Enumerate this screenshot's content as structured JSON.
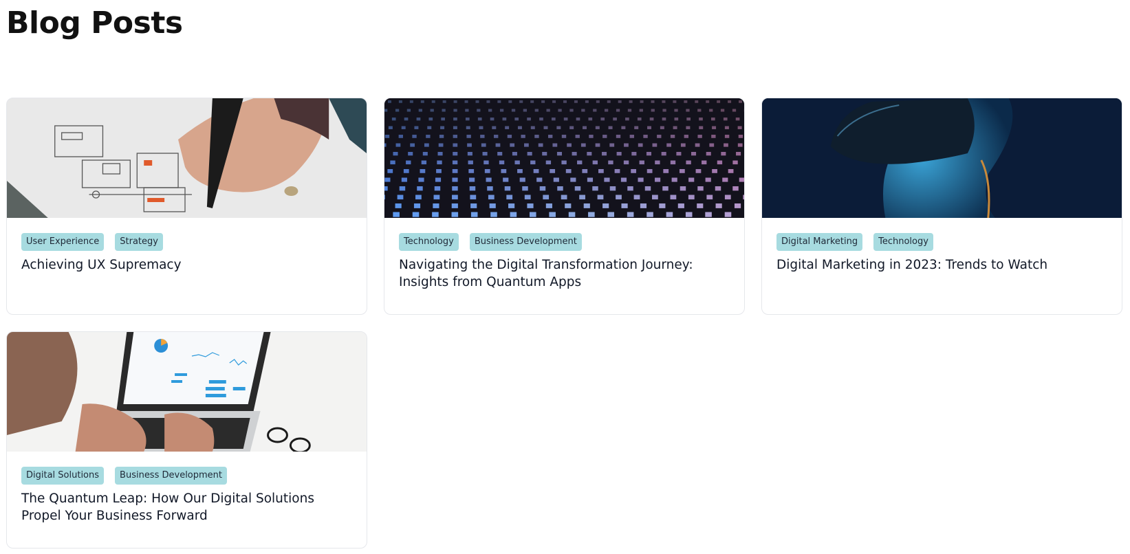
{
  "page": {
    "title": "Blog Posts"
  },
  "posts": [
    {
      "image": "hand-sketching-wireframe-image",
      "tags": [
        "User Experience",
        "Strategy"
      ],
      "title": "Achieving UX Supremacy"
    },
    {
      "image": "glowing-led-grid-image",
      "tags": [
        "Technology",
        "Business Development"
      ],
      "title": "Navigating the Digital Transformation Journey: Insights from Quantum Apps"
    },
    {
      "image": "person-vr-headset-image",
      "tags": [
        "Digital Marketing",
        "Technology"
      ],
      "title": "Digital Marketing in 2023: Trends to Watch"
    },
    {
      "image": "laptop-analytics-dashboard-image",
      "tags": [
        "Digital Solutions",
        "Business Development"
      ],
      "title": "The Quantum Leap: How Our Digital Solutions Propel Your Business Forward"
    }
  ],
  "colors": {
    "tag_background": "#a7dbe0",
    "card_border": "#e5e7eb",
    "title_text": "#111827"
  }
}
